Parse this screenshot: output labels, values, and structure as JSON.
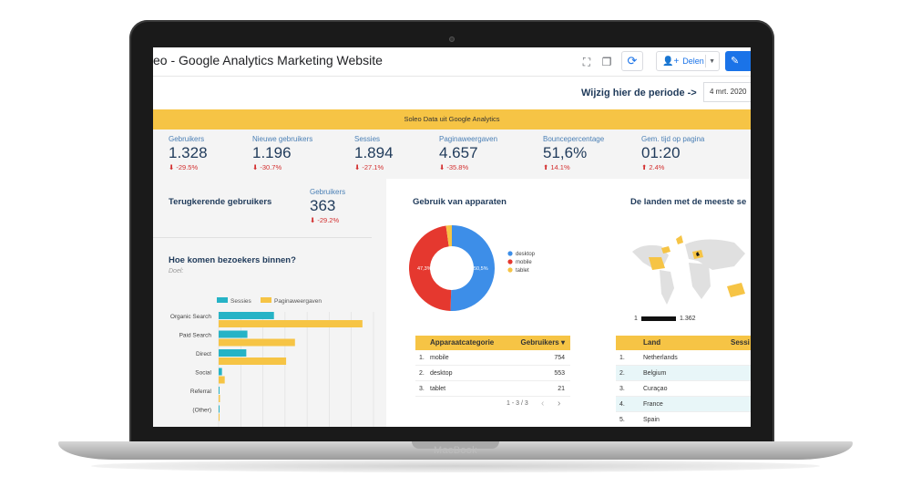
{
  "app": {
    "title": "eo - Google Analytics Marketing Website",
    "share_label": "Delen",
    "period_label": "Wijzig hier de periode ->",
    "date_value": "4 mrt. 2020",
    "banner": "Soleo Data uit Google Analytics",
    "laptop_brand": "MacBook"
  },
  "colors": {
    "accent": "#1a73e8",
    "yellow": "#f6c445",
    "navy": "#1f3a5a",
    "teal": "#26b3c6",
    "red": "#d32f2f"
  },
  "icons": {
    "fullscreen": "fullscreen-icon",
    "copy": "copy-icon",
    "refresh": "refresh-icon",
    "add_person": "add-person-icon",
    "edit": "pencil-icon"
  },
  "kpis": [
    {
      "label": "Gebruikers",
      "value": "1.328",
      "change": "⬇ -29.5%"
    },
    {
      "label": "Nieuwe gebruikers",
      "value": "1.196",
      "change": "⬇ -30.7%"
    },
    {
      "label": "Sessies",
      "value": "1.894",
      "change": "⬇ -27.1%"
    },
    {
      "label": "Paginaweergaven",
      "value": "4.657",
      "change": "⬇ -35.8%"
    },
    {
      "label": "Bouncepercentage",
      "value": "51,6%",
      "change": "⬆ 14.1%"
    },
    {
      "label": "Gem. tijd op pagina",
      "value": "01:20",
      "change": "⬆ 2.4%"
    }
  ],
  "returning": {
    "title": "Terugkerende gebruikers",
    "metric_label": "Gebruikers",
    "value": "363",
    "change": "⬇ -29.2%"
  },
  "acquisition": {
    "title": "Hoe komen bezoekers binnen?",
    "subtitle": "Doel:"
  },
  "devices": {
    "title": "Gebruik van apparaten",
    "center_left": "47,3%",
    "center_right": "50,5%"
  },
  "countries": {
    "title": "De landen met de meeste se",
    "scale_min": "1",
    "scale_max": "1.362"
  },
  "chart_data": [
    {
      "type": "bar",
      "orientation": "horizontal",
      "categories": [
        "Organic Search",
        "Paid Search",
        "Direct",
        "Social",
        "Referral",
        "(Other)"
      ],
      "series": [
        {
          "name": "Sessies",
          "values": [
            500,
            260,
            250,
            30,
            8,
            2
          ]
        },
        {
          "name": "Paginaweergaven",
          "values": [
            1300,
            690,
            610,
            55,
            12,
            4
          ]
        }
      ],
      "legend": "top"
    },
    {
      "type": "pie",
      "labels": [
        "desktop",
        "mobile",
        "tablet"
      ],
      "values": [
        50.5,
        47.3,
        2.2
      ],
      "legend": "right"
    }
  ],
  "device_table": {
    "headers": [
      "Apparaatcategorie",
      "Gebruikers ▾"
    ],
    "rows": [
      [
        "1.",
        "mobile",
        "754"
      ],
      [
        "2.",
        "desktop",
        "553"
      ],
      [
        "3.",
        "tablet",
        "21"
      ]
    ],
    "pagination": "1 - 3 / 3"
  },
  "country_table": {
    "headers": [
      "Land",
      "Sessi"
    ],
    "rows": [
      [
        "1.",
        "Netherlands"
      ],
      [
        "2.",
        "Belgium"
      ],
      [
        "3.",
        "Curaçao"
      ],
      [
        "4.",
        "France"
      ],
      [
        "5.",
        "Spain"
      ]
    ]
  }
}
